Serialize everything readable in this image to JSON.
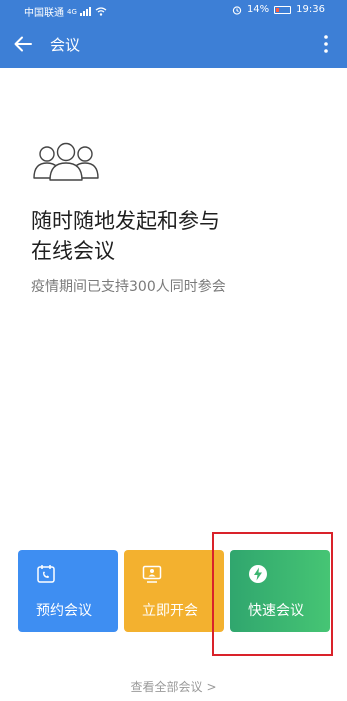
{
  "status_bar": {
    "carrier": "中国联通",
    "network": "4G",
    "battery": "14%",
    "time": "19:36",
    "battery_level": 0.14
  },
  "app_bar": {
    "title": "会议",
    "back_icon": "arrow-left-icon",
    "menu_icon": "more-vert-icon"
  },
  "hero": {
    "icon": "people-group-icon",
    "headline_line1": "随时随地发起和参与",
    "headline_line2": "在线会议",
    "subtitle": "疫情期间已支持300人同时参会"
  },
  "actions": [
    {
      "label": "预约会议",
      "icon": "calendar-phone-icon",
      "color": "#3e8ef2"
    },
    {
      "label": "立即开会",
      "icon": "monitor-icon",
      "color": "#f3b12f"
    },
    {
      "label": "快速会议",
      "icon": "lightning-icon",
      "color": "#3bb570"
    }
  ],
  "footer": {
    "view_all": "查看全部会议",
    "chevron": ">"
  },
  "colors": {
    "header": "#3d7fd6",
    "highlight": "#d9222a"
  }
}
